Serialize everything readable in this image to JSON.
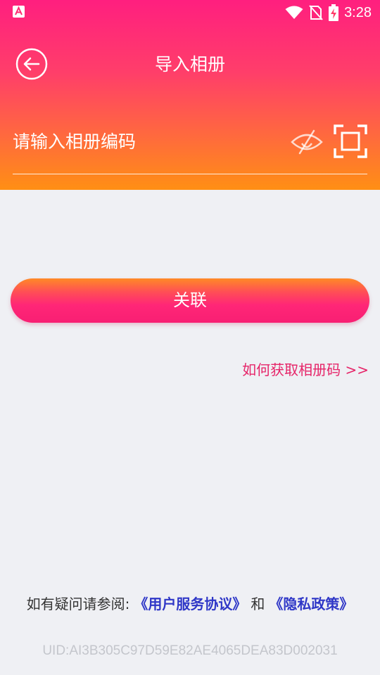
{
  "status_bar": {
    "time": "3:28",
    "icons": [
      "app-notification-icon",
      "wifi-icon",
      "no-sim-icon",
      "battery-charging-icon"
    ]
  },
  "header": {
    "title": "导入相册",
    "back_icon": "back-arrow-icon"
  },
  "input": {
    "placeholder": "请输入相册编码",
    "value": "",
    "visibility_icon": "eye-off-icon",
    "scan_icon": "scan-icon"
  },
  "actions": {
    "link_label": "关联",
    "how_to_label": "如何获取相册码 >>"
  },
  "footer": {
    "prefix": "如有疑问请参阅:",
    "user_agreement": "《用户服务协议》",
    "conjunction": "和",
    "privacy_policy": "《隐私政策》",
    "uid": "UID:AI3B305C97D59E82AE4065DEA83D002031"
  },
  "colors": {
    "gradient_top": "#ff1f7f",
    "gradient_bottom": "#ff8f14",
    "accent_pink": "#e62468",
    "link_blue": "#2f37c7",
    "background": "#eff0f4"
  }
}
